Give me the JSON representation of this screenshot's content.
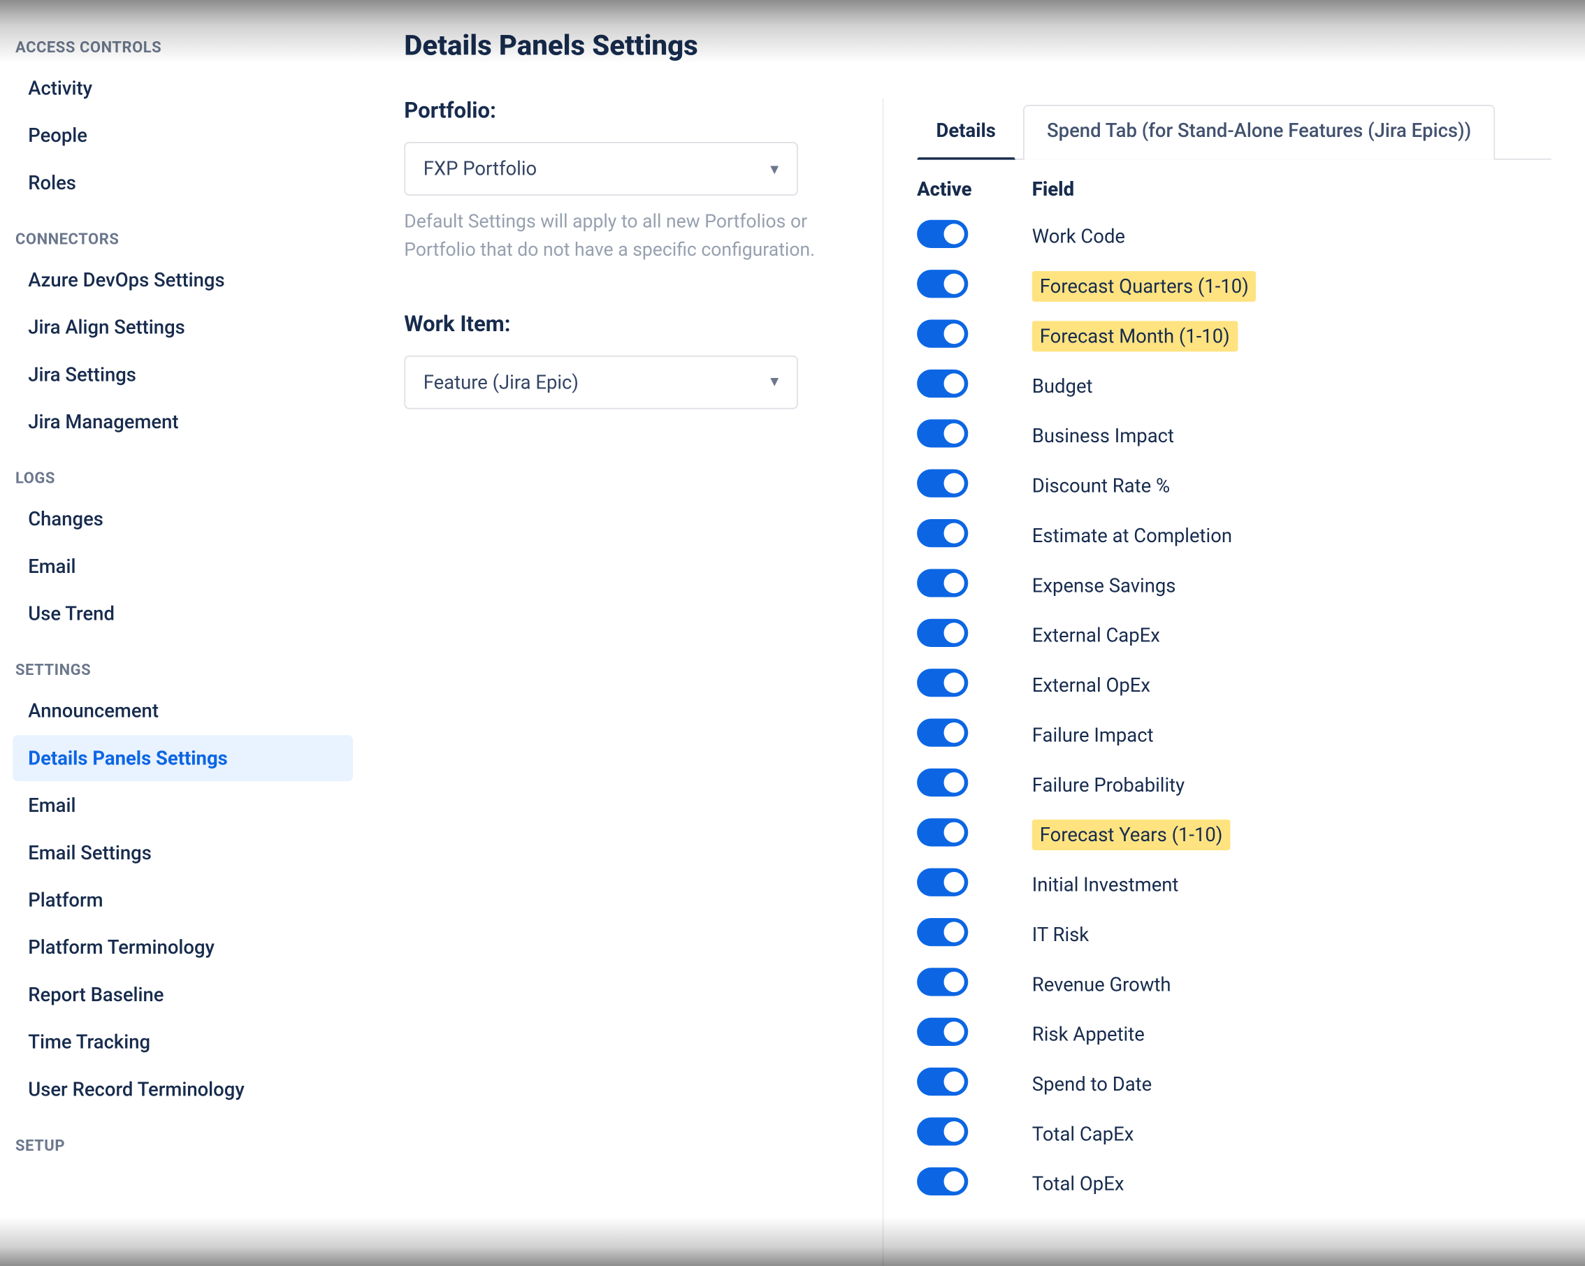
{
  "sidebar": {
    "sections": [
      {
        "label": "ACCESS CONTROLS",
        "items": [
          "Activity",
          "People",
          "Roles"
        ]
      },
      {
        "label": "CONNECTORS",
        "items": [
          "Azure DevOps Settings",
          "Jira Align Settings",
          "Jira Settings",
          "Jira Management"
        ]
      },
      {
        "label": "LOGS",
        "items": [
          "Changes",
          "Email",
          "Use Trend"
        ]
      },
      {
        "label": "SETTINGS",
        "items": [
          "Announcement",
          "Details Panels Settings",
          "Email",
          "Email Settings",
          "Platform",
          "Platform Terminology",
          "Report Baseline",
          "Time Tracking",
          "User Record Terminology"
        ]
      },
      {
        "label": "SETUP",
        "items": []
      }
    ],
    "active": "Details Panels Settings"
  },
  "main": {
    "title": "Details Panels Settings",
    "portfolio": {
      "label": "Portfolio:",
      "value": "FXP Portfolio",
      "hint": "Default Settings will apply to all new Portfolios or Portfolio that do not have a specific configuration."
    },
    "workitem": {
      "label": "Work Item:",
      "value": "Feature (Jira Epic)"
    },
    "tabs": {
      "details": "Details",
      "spend": "Spend Tab (for Stand-Alone Features (Jira Epics))",
      "active": "details"
    },
    "table": {
      "head_active": "Active",
      "head_field": "Field",
      "rows": [
        {
          "field": "Work Code",
          "active": true,
          "highlighted": false
        },
        {
          "field": "Forecast Quarters (1-10)",
          "active": true,
          "highlighted": true
        },
        {
          "field": "Forecast Month (1-10)",
          "active": true,
          "highlighted": true
        },
        {
          "field": "Budget",
          "active": true,
          "highlighted": false
        },
        {
          "field": "Business Impact",
          "active": true,
          "highlighted": false
        },
        {
          "field": "Discount Rate %",
          "active": true,
          "highlighted": false
        },
        {
          "field": "Estimate at Completion",
          "active": true,
          "highlighted": false
        },
        {
          "field": "Expense Savings",
          "active": true,
          "highlighted": false
        },
        {
          "field": "External CapEx",
          "active": true,
          "highlighted": false
        },
        {
          "field": "External OpEx",
          "active": true,
          "highlighted": false
        },
        {
          "field": "Failure Impact",
          "active": true,
          "highlighted": false
        },
        {
          "field": "Failure Probability",
          "active": true,
          "highlighted": false
        },
        {
          "field": "Forecast Years (1-10)",
          "active": true,
          "highlighted": true
        },
        {
          "field": "Initial Investment",
          "active": true,
          "highlighted": false
        },
        {
          "field": "IT Risk",
          "active": true,
          "highlighted": false
        },
        {
          "field": "Revenue Growth",
          "active": true,
          "highlighted": false
        },
        {
          "field": "Risk Appetite",
          "active": true,
          "highlighted": false
        },
        {
          "field": "Spend to Date",
          "active": true,
          "highlighted": false
        },
        {
          "field": "Total CapEx",
          "active": true,
          "highlighted": false
        },
        {
          "field": "Total OpEx",
          "active": true,
          "highlighted": false
        }
      ]
    }
  }
}
